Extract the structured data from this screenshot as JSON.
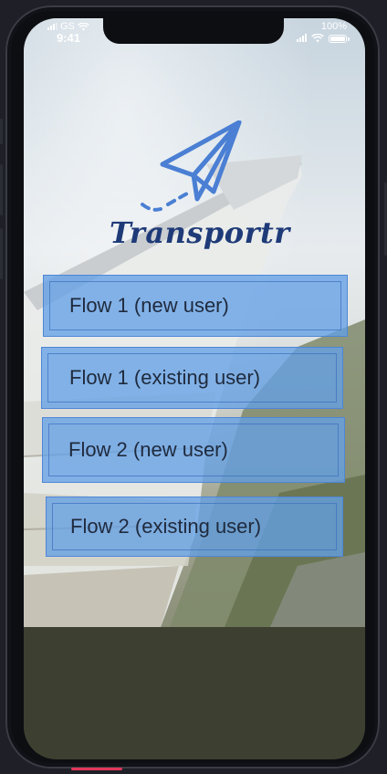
{
  "status_bar": {
    "carrier": "GS",
    "time": "9:41",
    "battery": "100%"
  },
  "app": {
    "brand_name": "Transportr",
    "logo_icon": "paper-plane-icon",
    "accent_color": "#4a7fd4"
  },
  "flows": [
    {
      "label": "Flow 1 (new user)"
    },
    {
      "label": "Flow 1 (existing user)"
    },
    {
      "label": "Flow 2 (new user)"
    },
    {
      "label": "Flow 2 (existing user)"
    }
  ]
}
